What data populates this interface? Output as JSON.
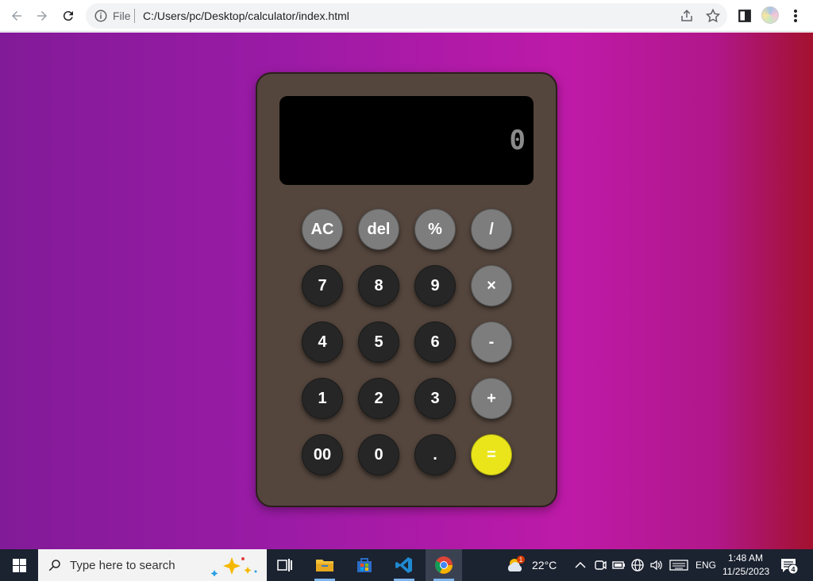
{
  "browser": {
    "scheme_label": "File",
    "url": "C:/Users/pc/Desktop/calculator/index.html"
  },
  "calculator": {
    "display_value": "0",
    "colors": {
      "body": "#54463d",
      "display": "#000000",
      "digit_key": "#262626",
      "operator_key": "#7d7d7d",
      "equals_key": "#eae51b"
    },
    "keys": [
      {
        "label": "AC",
        "style": "grey"
      },
      {
        "label": "del",
        "style": "grey"
      },
      {
        "label": "%",
        "style": "grey"
      },
      {
        "label": "/",
        "style": "grey"
      },
      {
        "label": "7",
        "style": "dark"
      },
      {
        "label": "8",
        "style": "dark"
      },
      {
        "label": "9",
        "style": "dark"
      },
      {
        "label": "×",
        "style": "grey"
      },
      {
        "label": "4",
        "style": "dark"
      },
      {
        "label": "5",
        "style": "dark"
      },
      {
        "label": "6",
        "style": "dark"
      },
      {
        "label": "-",
        "style": "grey"
      },
      {
        "label": "1",
        "style": "dark"
      },
      {
        "label": "2",
        "style": "dark"
      },
      {
        "label": "3",
        "style": "dark"
      },
      {
        "label": "+",
        "style": "grey"
      },
      {
        "label": "00",
        "style": "dark"
      },
      {
        "label": "0",
        "style": "dark"
      },
      {
        "label": ".",
        "style": "dark"
      },
      {
        "label": "=",
        "style": "yellow"
      }
    ]
  },
  "taskbar": {
    "search_placeholder": "Type here to search",
    "weather": {
      "temp": "22°C",
      "badge": "1"
    },
    "language": "ENG",
    "time": "1:48 AM",
    "date": "11/25/2023",
    "notification_count": "4"
  }
}
